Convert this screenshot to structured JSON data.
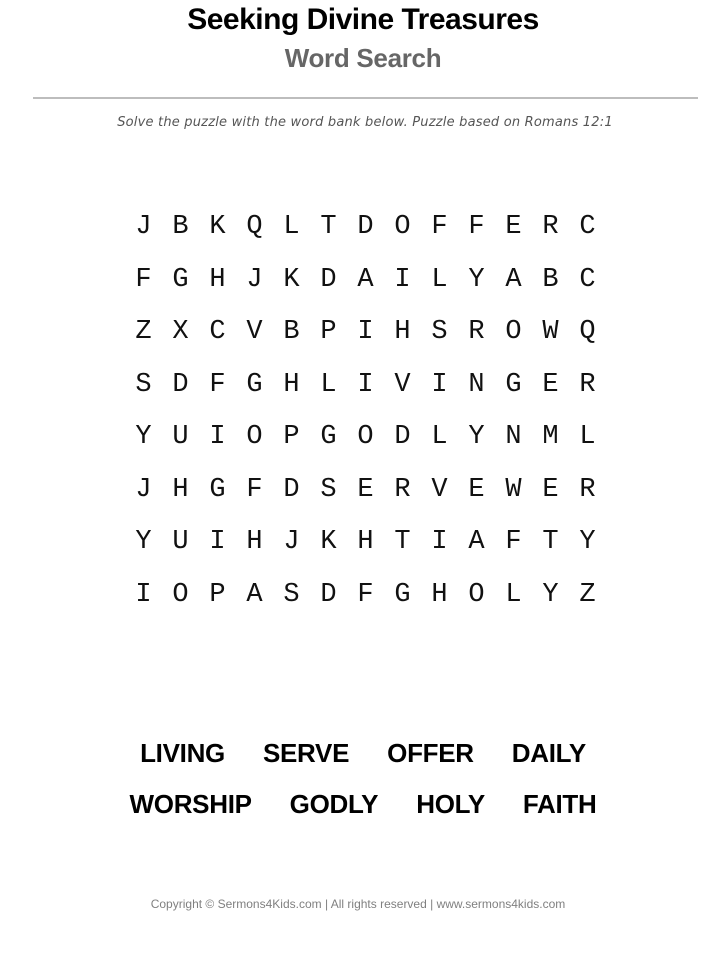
{
  "header": {
    "title": "Seeking Divine Treasures",
    "subtitle": "Word Search"
  },
  "instructions": "Solve the puzzle with the word bank below. Puzzle based on Romans 12:1",
  "grid": {
    "rows": [
      [
        "J",
        "B",
        "K",
        "Q",
        "L",
        "T",
        "D",
        "O",
        "F",
        "F",
        "E",
        "R",
        "C"
      ],
      [
        "F",
        "G",
        "H",
        "J",
        "K",
        "D",
        "A",
        "I",
        "L",
        "Y",
        "A",
        "B",
        "C"
      ],
      [
        "Z",
        "X",
        "C",
        "V",
        "B",
        "P",
        "I",
        "H",
        "S",
        "R",
        "O",
        "W",
        "Q"
      ],
      [
        "S",
        "D",
        "F",
        "G",
        "H",
        "L",
        "I",
        "V",
        "I",
        "N",
        "G",
        "E",
        "R"
      ],
      [
        "Y",
        "U",
        "I",
        "O",
        "P",
        "G",
        "O",
        "D",
        "L",
        "Y",
        "N",
        "M",
        "L"
      ],
      [
        "J",
        "H",
        "G",
        "F",
        "D",
        "S",
        "E",
        "R",
        "V",
        "E",
        "W",
        "E",
        "R"
      ],
      [
        "Y",
        "U",
        "I",
        "H",
        "J",
        "K",
        "H",
        "T",
        "I",
        "A",
        "F",
        "T",
        "Y"
      ],
      [
        "I",
        "O",
        "P",
        "A",
        "S",
        "D",
        "F",
        "G",
        "H",
        "O",
        "L",
        "Y",
        "Z"
      ]
    ]
  },
  "word_bank": {
    "rows": [
      [
        "LIVING",
        "SERVE",
        "OFFER",
        "DAILY"
      ],
      [
        "WORSHIP",
        "GODLY",
        "HOLY",
        "FAITH"
      ]
    ]
  },
  "footer": "Copyright © Sermons4Kids.com | All rights reserved | www.sermons4kids.com"
}
